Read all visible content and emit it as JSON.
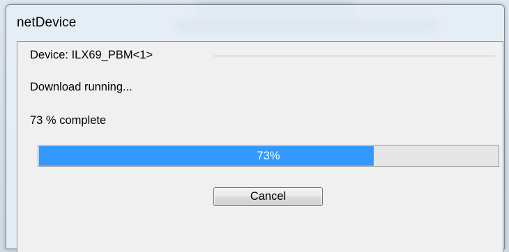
{
  "window": {
    "title": "netDevice"
  },
  "group": {
    "caption": "Device: ILX69_PBM<1>"
  },
  "status": {
    "message": "Download running...",
    "complete_text": "73 % complete"
  },
  "progress": {
    "percent": 73,
    "label": "73%",
    "fill_color": "#3399ff"
  },
  "buttons": {
    "cancel_label": "Cancel"
  }
}
